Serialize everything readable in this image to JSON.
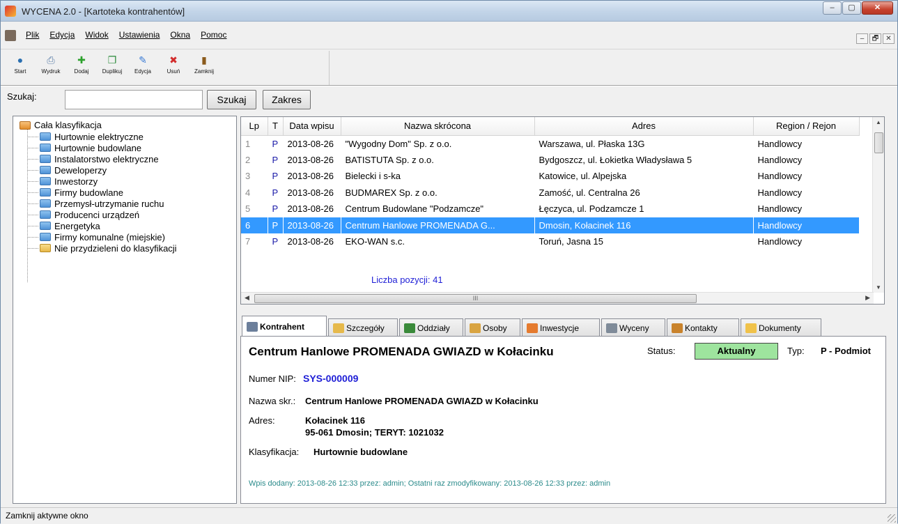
{
  "window": {
    "title": "WYCENA 2.0 - [Kartoteka kontrahentów]",
    "min": "–",
    "max": "▢",
    "close": "✕"
  },
  "menu": [
    "Plik",
    "Edycja",
    "Widok",
    "Ustawienia",
    "Okna",
    "Pomoc"
  ],
  "mdi_buttons": [
    "–",
    "🗗",
    "✕"
  ],
  "toolbar": [
    {
      "label": "Start",
      "icon": "start-icon",
      "glyph": "●",
      "color": "#2a6fb0"
    },
    {
      "label": "Wydruk",
      "icon": "print-icon",
      "glyph": "⎙",
      "color": "#5a7ea8"
    },
    {
      "label": "Dodaj",
      "icon": "add-icon",
      "glyph": "✚",
      "color": "#2da12d"
    },
    {
      "label": "Duplikuj",
      "icon": "duplicate-icon",
      "glyph": "❐",
      "color": "#2b8b3b"
    },
    {
      "label": "Edycja",
      "icon": "edit-icon",
      "glyph": "✎",
      "color": "#3a7bd5"
    },
    {
      "label": "Usuń",
      "icon": "delete-icon",
      "glyph": "✖",
      "color": "#d22b2b"
    },
    {
      "label": "Zamknij",
      "icon": "exit-door-icon",
      "glyph": "▮",
      "color": "#8a5a1c"
    }
  ],
  "search": {
    "label": "Szukaj:",
    "value": "",
    "search_button": "Szukaj",
    "range_button": "Zakres"
  },
  "tree": {
    "root": "Cała klasyfikacja",
    "items": [
      "Hurtownie elektryczne",
      "Hurtownie budowlane",
      "Instalatorstwo elektryczne",
      "Deweloperzy",
      "Inwestorzy",
      "Firmy budowlane",
      "Przemysł-utrzymanie ruchu",
      "Producenci urządzeń",
      "Energetyka",
      "Firmy komunalne (miejskie)",
      "Nie przydzieleni do klasyfikacji"
    ]
  },
  "grid": {
    "columns": [
      "Lp",
      "T",
      "Data wpisu",
      "Nazwa skrócona",
      "Adres",
      "Region / Rejon"
    ],
    "rows": [
      [
        "1",
        "P",
        "2013-08-26",
        "\"Wygodny Dom\" Sp. z o.o.",
        "Warszawa, ul. Płaska 13G",
        "Handlowcy"
      ],
      [
        "2",
        "P",
        "2013-08-26",
        "BATISTUTA Sp. z o.o.",
        "Bydgoszcz, ul. Łokietka Władysława 5",
        "Handlowcy"
      ],
      [
        "3",
        "P",
        "2013-08-26",
        "Bielecki i s-ka",
        "Katowice, ul. Alpejska",
        "Handlowcy"
      ],
      [
        "4",
        "P",
        "2013-08-26",
        "BUDMAREX Sp. z o.o.",
        "Zamość, ul. Centralna 26",
        "Handlowcy"
      ],
      [
        "5",
        "P",
        "2013-08-26",
        "Centrum Budowlane \"Podzamcze\"",
        "Łęczyca, ul. Podzamcze 1",
        "Handlowcy"
      ],
      [
        "6",
        "P",
        "2013-08-26",
        "Centrum Hanlowe PROMENADA G...",
        "Dmosin, Kołacinek 116",
        "Handlowcy"
      ],
      [
        "7",
        "P",
        "2013-08-26",
        "EKO-WAN s.c.",
        "Toruń, Jasna 15",
        "Handlowcy"
      ]
    ],
    "selected_row": 6,
    "count_text": "Liczba pozycji: 41",
    "hscroll_grip": "III"
  },
  "tabs": [
    {
      "label": "Kontrahent",
      "icon": "contractor-icon",
      "color": "#6c7f9b"
    },
    {
      "label": "Szczegóły",
      "icon": "details-icon",
      "color": "#e6b94b"
    },
    {
      "label": "Oddziały",
      "icon": "branches-icon",
      "color": "#3a8a3a"
    },
    {
      "label": "Osoby",
      "icon": "people-icon",
      "color": "#d9a441"
    },
    {
      "label": "Inwestycje",
      "icon": "investments-icon",
      "color": "#e57b2f"
    },
    {
      "label": "Wyceny",
      "icon": "quotes-icon",
      "color": "#7f8b99"
    },
    {
      "label": "Kontakty",
      "icon": "contacts-icon",
      "color": "#c9832c"
    },
    {
      "label": "Dokumenty",
      "icon": "documents-folder-icon",
      "color": "#f0c24a"
    }
  ],
  "detail": {
    "name": "Centrum Hanlowe PROMENADA GWIAZD w Kołacinku",
    "status_label": "Status:",
    "status": "Aktualny",
    "typ_label": "Typ:",
    "typ": "P - Podmiot",
    "nip_label": "Numer NIP:",
    "nip": "SYS-000009",
    "short_name_label": "Nazwa skr.:",
    "short_name": "Centrum Hanlowe PROMENADA GWIAZD w Kołacinku",
    "address_label": "Adres:",
    "address_line1": "Kołacinek 116",
    "address_line2": "95-061 Dmosin; TERYT: 1021032",
    "class_label": "Klasyfikacja:",
    "classification": "Hurtownie budowlane",
    "footer": "Wpis dodany: 2013-08-26 12:33 przez: admin; Ostatni raz zmodyfikowany: 2013-08-26 12:33 przez: admin"
  },
  "statusbar": {
    "text": "Zamknij aktywne okno"
  },
  "colors": {
    "selection": "#3399ff",
    "link_blue": "#1e1ed6",
    "status_green": "#9ee49e",
    "footer_teal": "#2b8b8b"
  }
}
